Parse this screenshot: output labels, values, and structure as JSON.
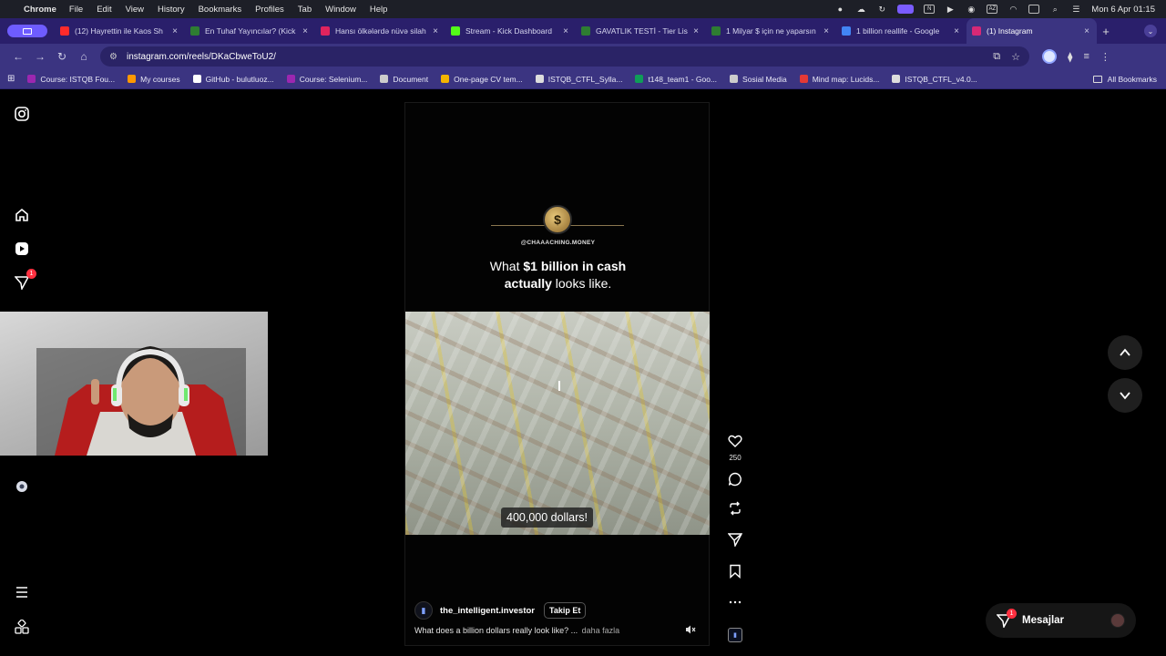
{
  "menubar": {
    "app": "Chrome",
    "items": [
      "File",
      "Edit",
      "View",
      "History",
      "Bookmarks",
      "Profiles",
      "Tab",
      "Window",
      "Help"
    ],
    "input_source": "AZ",
    "clock": "Mon 6 Apr  01:15"
  },
  "tabs": [
    {
      "title": "(12) Hayrettin ile Kaos Sh",
      "color": "#ff2b2b"
    },
    {
      "title": "En Tuhaf Yayıncılar? (Kick",
      "color": "#2e7d32"
    },
    {
      "title": "Hansı ölkələrdə nüvə silah",
      "color": "#e0245e"
    },
    {
      "title": "Stream - Kick Dashboard",
      "color": "#53fc18"
    },
    {
      "title": "GAVATLIK TESTİ - Tier Lis",
      "color": "#2e7d32"
    },
    {
      "title": "1 Milyar $ için ne yaparsın",
      "color": "#2e7d32"
    },
    {
      "title": "1 billion reallife - Google",
      "color": "#4285f4"
    },
    {
      "title": "(1) Instagram",
      "color": "#d62976"
    }
  ],
  "toolbar": {
    "url": "instagram.com/reels/DKaCbweToU2/"
  },
  "bookmarks": {
    "items": [
      {
        "label": "Course: ISTQB Fou...",
        "color": "#9c27b0"
      },
      {
        "label": "My courses",
        "color": "#ff9800"
      },
      {
        "label": "GitHub - bulutluoz...",
        "color": "#ffffff"
      },
      {
        "label": "Course: Selenium...",
        "color": "#9c27b0"
      },
      {
        "label": "Document",
        "color": "#cccccc"
      },
      {
        "label": "One-page CV tem...",
        "color": "#f4b400"
      },
      {
        "label": "ISTQB_CTFL_Sylla...",
        "color": "#dddddd"
      },
      {
        "label": "t148_team1 - Goo...",
        "color": "#0f9d58"
      },
      {
        "label": "Sosial Media",
        "color": "#cccccc"
      },
      {
        "label": "Mind map: Lucids...",
        "color": "#e53935"
      },
      {
        "label": "ISTQB_CTFL_v4.0...",
        "color": "#dddddd"
      }
    ],
    "all": "All Bookmarks"
  },
  "sidebar": {
    "notifications_badge": "1"
  },
  "reel": {
    "handle": "@CHAAACHING.MONEY",
    "caption_pre": "What ",
    "caption_bold": "$1 billion in cash",
    "caption_bold2": "actually",
    "caption_post": " looks like.",
    "money_label": "400,000 dollars!",
    "author": "the_intelligent.investor",
    "follow_label": "Takip Et",
    "description": "What does a billion dollars really look like? ...",
    "more_label": "daha fazla",
    "likes": "250"
  },
  "messages": {
    "label": "Mesajlar",
    "badge": "1"
  },
  "colors": {
    "accent": "#3b3481",
    "badge": "#ff3040"
  }
}
